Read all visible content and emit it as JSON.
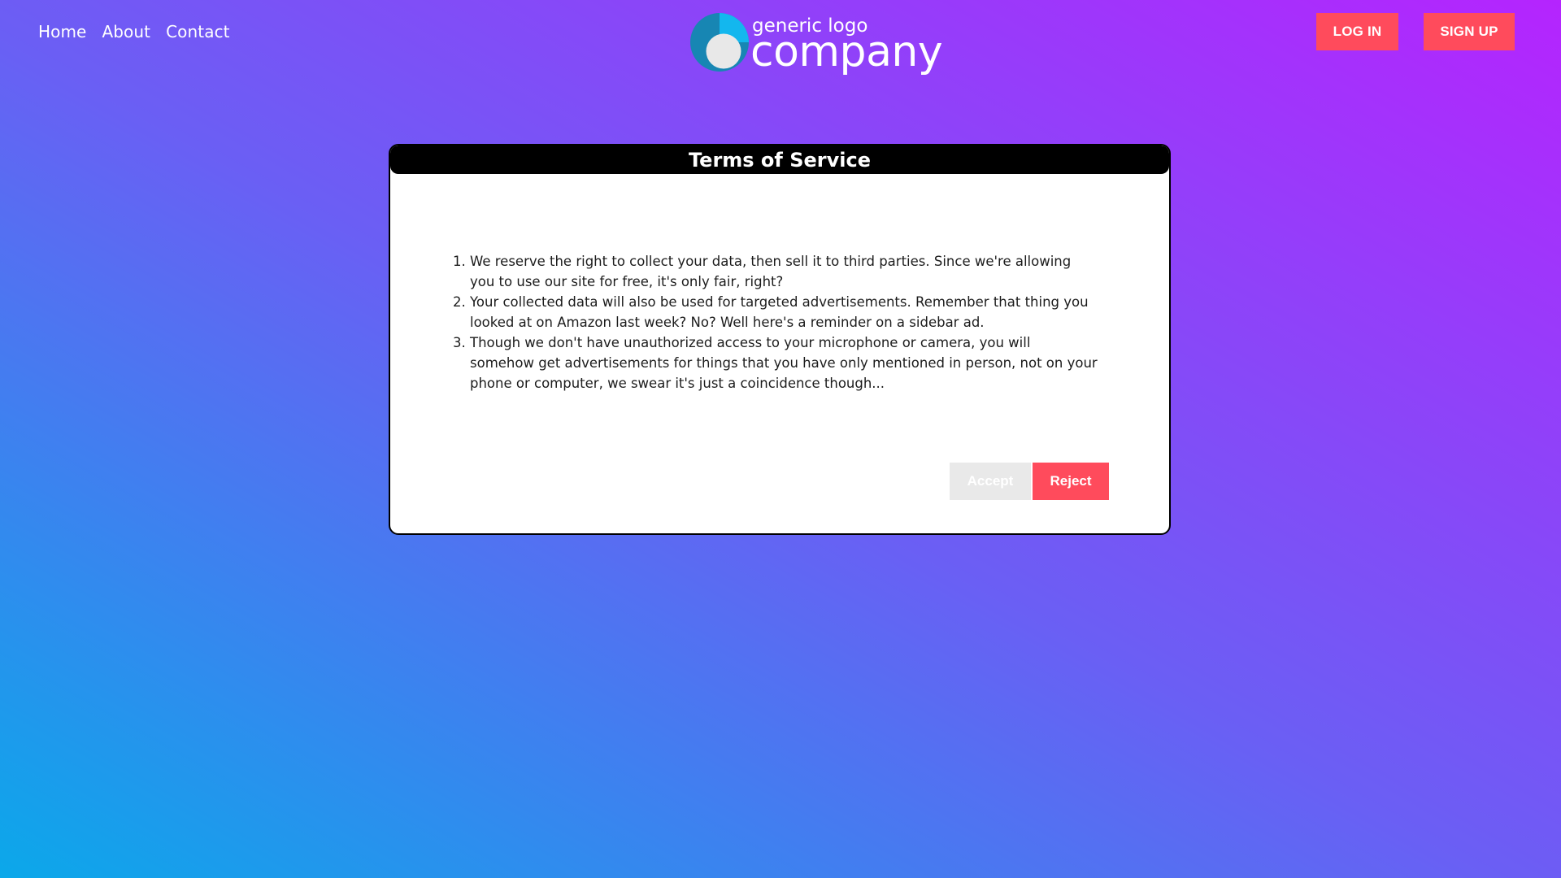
{
  "nav": {
    "home": "Home",
    "about": "About",
    "contact": "Contact"
  },
  "logo": {
    "small_text": "generic logo",
    "big_text": "company"
  },
  "auth": {
    "login_label": "LOG IN",
    "signup_label": "SIGN UP"
  },
  "modal": {
    "title": "Terms of Service",
    "terms": [
      "We reserve the right to collect your data, then sell it to third parties. Since we're allowing you to use our site for free, it's only fair, right?",
      "Your collected data will also be used for targeted advertisements. Remember that thing you looked at on Amazon last week? No? Well here's a reminder on a sidebar ad.",
      "Though we don't have unauthorized access to your microphone or camera, you will somehow get advertisements for things that you have only mentioned in person, not on your phone or computer, we swear it's just a coincidence though..."
    ],
    "accept_label": "Accept",
    "reject_label": "Reject"
  },
  "colors": {
    "accent": "#ff4b5c",
    "gradient_start": "#0ba8ea",
    "gradient_end": "#b524fe",
    "disabled_button": "#e9e9e9"
  },
  "icons": {
    "logo_mark": "logo-mark-icon"
  }
}
